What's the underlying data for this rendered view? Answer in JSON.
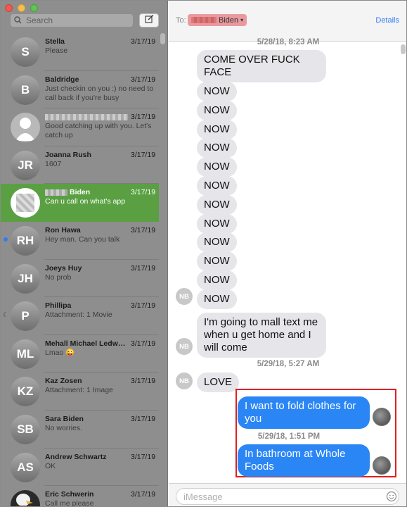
{
  "window": {
    "controls": [
      "close",
      "minimize",
      "zoom"
    ]
  },
  "sidebar": {
    "search": {
      "placeholder": "Search"
    },
    "compose_icon": "compose-icon",
    "conversations": [
      {
        "name": "Stella",
        "date": "3/17/19",
        "preview": "Please",
        "avatar": "S"
      },
      {
        "name": "Baldridge",
        "date": "3/17/19",
        "preview": "Just checkin on you :) no need to call back if you're busy",
        "avatar": "B"
      },
      {
        "name": "",
        "date": "3/17/19",
        "preview": "Good catching up with you. Let's catch up",
        "avatar": "person-silhouette-icon",
        "name_redacted": true
      },
      {
        "name": "Joanna Rush",
        "date": "3/17/19",
        "preview": "1607",
        "avatar": "JR"
      },
      {
        "name": "Biden",
        "date": "3/17/19",
        "preview": "Can u call on what's app",
        "avatar": "",
        "selected": true,
        "name_redacted": true
      },
      {
        "name": "Ron Hawa",
        "date": "3/17/19",
        "preview": "Hey man. Can you talk",
        "avatar": "RH",
        "unread": true
      },
      {
        "name": "Joeys Huy",
        "date": "3/17/19",
        "preview": "No prob",
        "avatar": "JH"
      },
      {
        "name": "Phillipa",
        "date": "3/17/19",
        "preview": "Attachment: 1 Movie",
        "avatar": "P",
        "muted": true
      },
      {
        "name": "Mehall Michael Ledw…",
        "date": "3/17/19",
        "preview": "Lmao 😜",
        "avatar": "ML"
      },
      {
        "name": "Kaz Zosen",
        "date": "3/17/19",
        "preview": "Attachment: 1 Image",
        "avatar": "KZ"
      },
      {
        "name": "Sara Biden",
        "date": "3/17/19",
        "preview": "No worries.",
        "avatar": "SB"
      },
      {
        "name": "Andrew Schwartz",
        "date": "3/17/19",
        "preview": "OK",
        "avatar": "AS"
      },
      {
        "name": "Eric Schwerin",
        "date": "3/17/19",
        "preview": "Call me please",
        "avatar": "eagle-photo"
      }
    ]
  },
  "header": {
    "to_label": "To:",
    "recipient": "Biden",
    "details": "Details"
  },
  "messages": {
    "ts1": "5/28/18, 8:23 AM",
    "m1": "COME OVER FUCK FACE",
    "now": "NOW",
    "nb": "NB",
    "m2": "I'm going to mall text me when u get home and I will come",
    "ts2": "5/29/18, 5:27 AM",
    "m3": "LOVE",
    "m4": "I want to fold clothes for you",
    "ts3": "5/29/18, 1:51 PM",
    "m5": "In bathroom at Whole Foods"
  },
  "composer": {
    "placeholder": "iMessage",
    "emoji_icon": "emoji-icon"
  },
  "colors": {
    "selected_row": "#5aa043",
    "my_bubble": "#2b86f5",
    "their_bubble": "#e5e5ea",
    "highlight": "#e02020"
  }
}
